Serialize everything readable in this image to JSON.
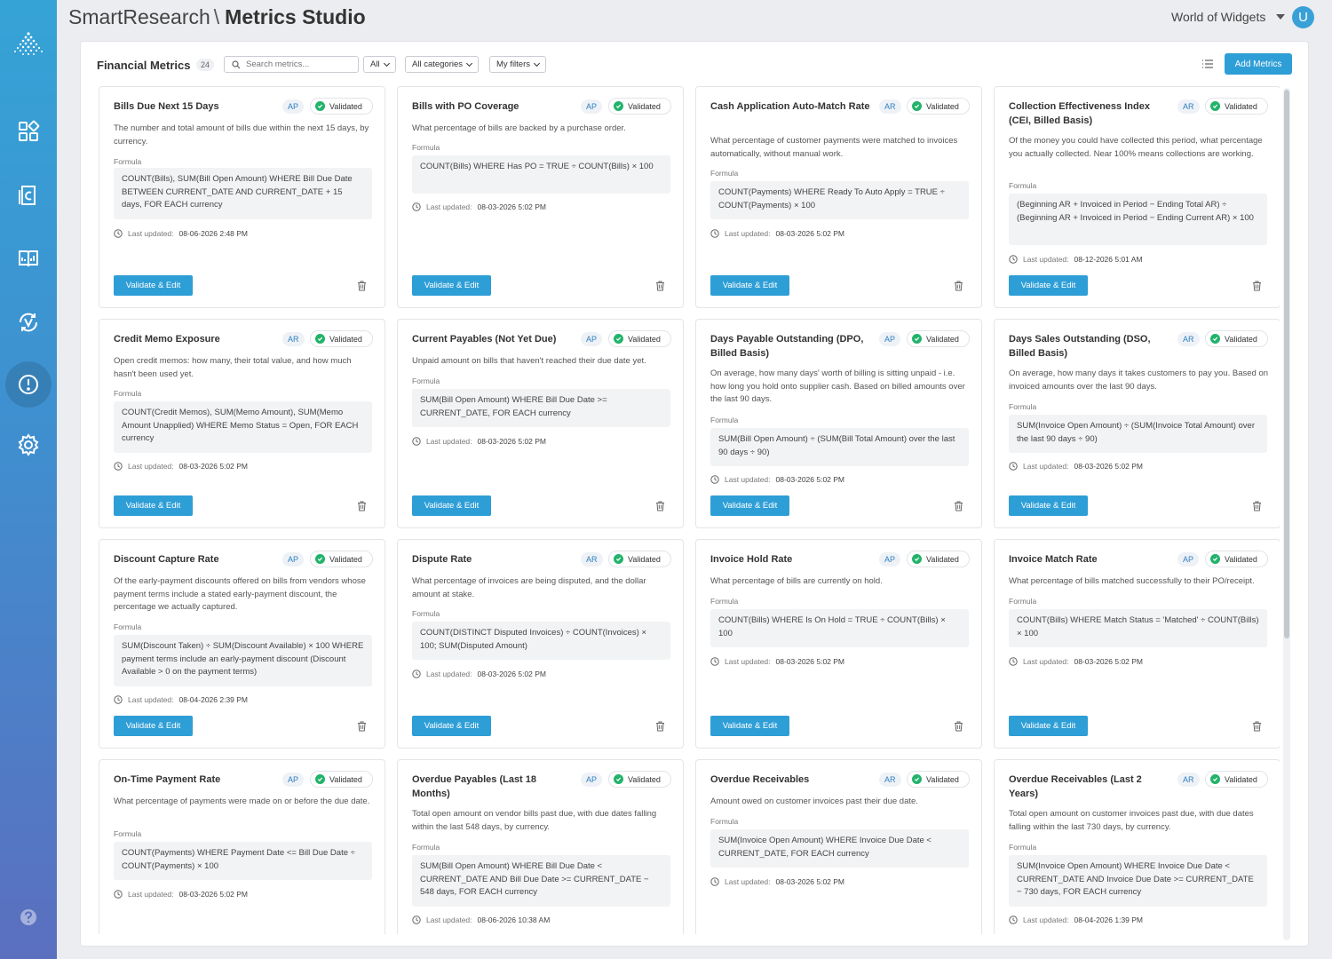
{
  "header": {
    "brand": "SmartResearch",
    "separator": "\\",
    "studio": "Metrics Studio",
    "workspace": "World of Widgets",
    "avatar_initial": "U"
  },
  "sidebar": {
    "items": [
      "apps-icon",
      "c-document-icon",
      "book-chart-icon",
      "v-refresh-icon",
      "alert-circle-icon",
      "gear-icon"
    ],
    "active": "alert-circle-icon",
    "help": "help-icon"
  },
  "toolbar": {
    "title": "Financial Metrics",
    "count": "24",
    "search_placeholder": "Search metrics...",
    "filter_all": "All",
    "filter_categories": "All categories",
    "filter_my": "My filters",
    "add_label": "Add Metrics"
  },
  "labels": {
    "formula": "Formula",
    "last_updated": "Last updated:",
    "validated": "Validated",
    "validate_edit": "Validate & Edit"
  },
  "colors": {
    "accent": "#2e9ed6",
    "validated": "#23b36b",
    "tag_text": "#2e7fc0"
  },
  "cards": [
    {
      "title": "Bills Due Next 15 Days",
      "tag": "AP",
      "desc": "The number and total amount of bills due within the next 15 days, by currency.",
      "formula": "COUNT(Bills), SUM(Bill Open Amount) WHERE Bill Due Date BETWEEN CURRENT_DATE AND CURRENT_DATE + 15 days, FOR EACH currency",
      "updated": "08-06-2026 2:48 PM"
    },
    {
      "title": "Bills with PO Coverage",
      "tag": "AP",
      "desc": "What percentage of bills are backed by a purchase order.",
      "formula": "COUNT(Bills) WHERE Has PO = TRUE ÷ COUNT(Bills) × 100",
      "updated": "08-03-2026 5:02 PM"
    },
    {
      "title": "Cash Application Auto-Match Rate",
      "tag": "AR",
      "desc": "What percentage of customer payments were matched to invoices automatically, without manual work.",
      "formula": "COUNT(Payments) WHERE Ready To Auto Apply = TRUE ÷ COUNT(Payments) × 100",
      "updated": "08-03-2026 5:02 PM"
    },
    {
      "title": "Collection Effectiveness Index (CEI, Billed Basis)",
      "tag": "AR",
      "desc": "Of the money you could have collected this period, what percentage you actually collected. Near 100% means collections are working.",
      "formula": "(Beginning AR + Invoiced in Period − Ending Total AR) ÷ (Beginning AR + Invoiced in Period − Ending Current AR) × 100",
      "updated": "08-12-2026 5:01 AM"
    },
    {
      "title": "Credit Memo Exposure",
      "tag": "AR",
      "desc": "Open credit memos: how many, their total value, and how much hasn't been used yet.",
      "formula": "COUNT(Credit Memos), SUM(Memo Amount), SUM(Memo Amount Unapplied) WHERE Memo Status = Open, FOR EACH currency",
      "updated": "08-03-2026 5:02 PM"
    },
    {
      "title": "Current Payables (Not Yet Due)",
      "tag": "AP",
      "desc": "Unpaid amount on bills that haven't reached their due date yet.",
      "formula": "SUM(Bill Open Amount) WHERE Bill Due Date >= CURRENT_DATE, FOR EACH currency",
      "updated": "08-03-2026 5:02 PM"
    },
    {
      "title": "Days Payable Outstanding (DPO, Billed Basis)",
      "tag": "AP",
      "desc": "On average, how many days' worth of billing is sitting unpaid - i.e. how long you hold onto supplier cash. Based on billed amounts over the last 90 days.",
      "formula": "SUM(Bill Open Amount) ÷ (SUM(Bill Total Amount) over the last 90 days ÷ 90)",
      "updated": "08-03-2026 5:02 PM"
    },
    {
      "title": "Days Sales Outstanding (DSO, Billed Basis)",
      "tag": "AR",
      "desc": "On average, how many days it takes customers to pay you. Based on invoiced amounts over the last 90 days.",
      "formula": "SUM(Invoice Open Amount) ÷ (SUM(Invoice Total Amount) over the last 90 days ÷ 90)",
      "updated": "08-03-2026 5:02 PM"
    },
    {
      "title": "Discount Capture Rate",
      "tag": "AP",
      "desc": "Of the early-payment discounts offered on bills from vendors whose payment terms include a stated early-payment discount, the percentage we actually captured.",
      "formula": "SUM(Discount Taken) ÷ SUM(Discount Available) × 100 WHERE payment terms include an early-payment discount (Discount Available > 0 on the payment terms)",
      "updated": "08-04-2026 2:39 PM"
    },
    {
      "title": "Dispute Rate",
      "tag": "AR",
      "desc": "What percentage of invoices are being disputed, and the dollar amount at stake.",
      "formula": "COUNT(DISTINCT Disputed Invoices) ÷ COUNT(Invoices) × 100; SUM(Disputed Amount)",
      "updated": "08-03-2026 5:02 PM"
    },
    {
      "title": "Invoice Hold Rate",
      "tag": "AP",
      "desc": "What percentage of bills are currently on hold.",
      "formula": "COUNT(Bills) WHERE Is On Hold = TRUE ÷ COUNT(Bills) × 100",
      "updated": "08-03-2026 5:02 PM"
    },
    {
      "title": "Invoice Match Rate",
      "tag": "AP",
      "desc": "What percentage of bills matched successfully to their PO/receipt.",
      "formula": "COUNT(Bills) WHERE Match Status = 'Matched' ÷ COUNT(Bills) × 100",
      "updated": "08-03-2026 5:02 PM"
    },
    {
      "title": "On-Time Payment Rate",
      "tag": "AP",
      "desc": "What percentage of payments were made on or before the due date.",
      "formula": "COUNT(Payments) WHERE Payment Date <= Bill Due Date ÷ COUNT(Payments) × 100",
      "updated": "08-03-2026 5:02 PM"
    },
    {
      "title": "Overdue Payables (Last 18 Months)",
      "tag": "AP",
      "desc": "Total open amount on vendor bills past due, with due dates falling within the last 548 days, by currency.",
      "formula": "SUM(Bill Open Amount) WHERE Bill Due Date < CURRENT_DATE AND Bill Due Date >= CURRENT_DATE − 548 days, FOR EACH currency",
      "updated": "08-06-2026 10:38 AM"
    },
    {
      "title": "Overdue Receivables",
      "tag": "AR",
      "desc": "Amount owed on customer invoices past their due date.",
      "formula": "SUM(Invoice Open Amount) WHERE Invoice Due Date < CURRENT_DATE, FOR EACH currency",
      "updated": "08-03-2026 5:02 PM"
    },
    {
      "title": "Overdue Receivables (Last 2 Years)",
      "tag": "AR",
      "desc": "Total open amount on customer invoices past due, with due dates falling within the last 730 days, by currency.",
      "formula": "SUM(Invoice Open Amount) WHERE Invoice Due Date < CURRENT_DATE AND Invoice Due Date >= CURRENT_DATE − 730 days, FOR EACH currency",
      "updated": "08-04-2026 1:39 PM"
    }
  ]
}
